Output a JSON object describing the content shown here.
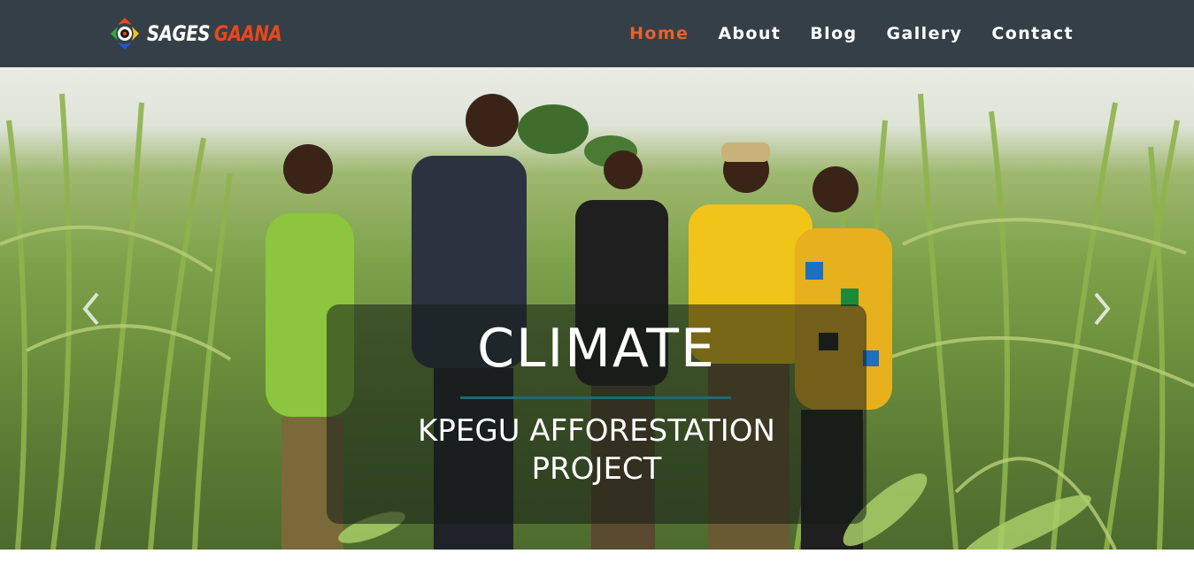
{
  "brand": {
    "word1": "SAGES",
    "word2": "GAANA",
    "icon": "sages-gaana-logo-icon",
    "accent_color": "#e8481c"
  },
  "nav": {
    "items": [
      {
        "label": "Home",
        "active": true
      },
      {
        "label": "About",
        "active": false
      },
      {
        "label": "Blog",
        "active": false
      },
      {
        "label": "Gallery",
        "active": false
      },
      {
        "label": "Contact",
        "active": false
      }
    ],
    "background_color": "#353f47",
    "active_color": "#e8622c"
  },
  "hero": {
    "title": "CLIMATE",
    "subtitle": "KPEGU AFFORESTATION PROJECT",
    "prev_icon": "chevron-left-icon",
    "next_icon": "chevron-right-icon",
    "rule_color": "#1b6c75"
  }
}
